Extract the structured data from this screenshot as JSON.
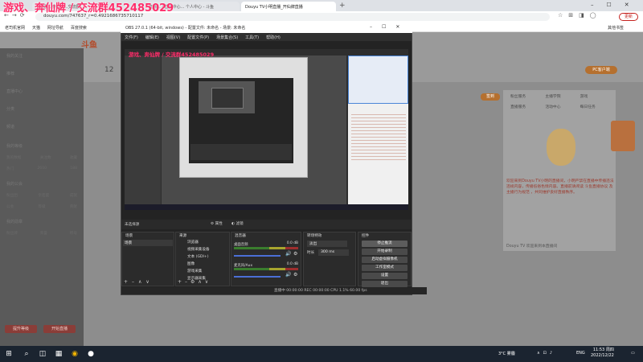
{
  "overlay_text": "游戏、奔仙牌 / 交流群452485029",
  "browser": {
    "tabs": [
      {
        "label": "交流群...奔仙牌...交流群...",
        "active": false
      },
      {
        "label": "直播... / 直播中心... 个人中心 - 斗鱼",
        "active": false
      },
      {
        "label": "Douyu TV小明直播_开仙牌直播",
        "active": true
      }
    ],
    "new_tab": "+",
    "url": "douyu.com/747637_r=0.4921686735710117",
    "bookmarks": [
      "老司机官网",
      "天猫",
      "网址导航",
      "百度搜索",
      "其他书签"
    ],
    "update_btn": "更新"
  },
  "site": {
    "logo": "斗鱼",
    "sidebar": {
      "items": [
        "我的关注",
        "推荐",
        "直播中心",
        "分类",
        "频道"
      ],
      "sections": [
        {
          "title": "我的等级",
          "rows": [
            [
              "我的数据",
              "1",
              "关注数",
              "0",
              "收藏",
              "0"
            ],
            [
              "热门",
              "2600",
              "开播量",
              "0",
              "在线",
              "188"
            ]
          ]
        },
        {
          "title": "我的公会",
          "rows": [
            [
              "粉丝团",
              "0",
              "亲密度",
              "0",
              "成就",
              "0"
            ],
            [
              "公会",
              "1",
              "等级",
              "3",
              "贡献",
              "0"
            ]
          ]
        },
        {
          "title": "我的勋章",
          "rows": [
            [
              "粉丝牌",
              "0",
              "荣誉",
              "0",
              "称号",
              "0"
            ]
          ]
        }
      ],
      "btn1": "提升等级",
      "btn2": "开始直播"
    },
    "topright": {
      "pc_badge": "PC客户端",
      "open_stream": "开播",
      "checkin": "签到"
    },
    "right_panel": {
      "rows": [
        "粉丝服务",
        "主播学院",
        "游戏",
        "直播服务",
        "活动中心",
        "每日任务"
      ],
      "text": "欢迎来到Douyu TV小明的直播间，小明严禁在直播中传播违法违规内容，传播低俗色情内容。直播前请阅读 斗鱼直播协议 及 主播行为规范 ，共同维护良好直播秩序。",
      "footer": "Douyu TV 欢迎来到本直播间"
    },
    "left_ticker": "12"
  },
  "obs": {
    "title": "OBS 27.0.1 (64-bit, windows) - 配置文件: 未命名 - 场景: 未命名",
    "menu": [
      "文件(F)",
      "编辑(E)",
      "视图(V)",
      "配置文件(P)",
      "场景集合(S)",
      "工具(T)",
      "帮助(H)"
    ],
    "status_bar": "直播中 00:00:00 REC 00:00:00 CPU 1.1% 60.00 fps",
    "preview_label": "未选择源",
    "props_btn": "属性",
    "filters_btn": "滤镜",
    "docks": {
      "scenes": {
        "title": "场景",
        "items": [
          "场景"
        ]
      },
      "sources": {
        "title": "来源",
        "items": [
          "浏览器",
          "视频采集设备",
          "文本 (GDI+)",
          "图像",
          "游戏采集",
          "显示器采集"
        ]
      },
      "mixer": {
        "title": "混音器",
        "channels": [
          {
            "name": "桌面音频",
            "db": "0.0 dB"
          },
          {
            "name": "麦克风/Aux",
            "db": "0.0 dB"
          }
        ]
      },
      "transitions": {
        "title": "转场特效",
        "type": "淡出",
        "duration_label": "时长",
        "duration": "300 ms"
      },
      "controls": {
        "title": "控件",
        "buttons": [
          "停止推流",
          "开始录制",
          "启动虚拟摄像机",
          "工作室模式",
          "设置",
          "退出"
        ]
      }
    }
  },
  "taskbar": {
    "weather": "3°C 雾霾",
    "lang": "ENG",
    "time": "11:53 周四",
    "date": "2022/12/22"
  },
  "colors": {
    "orange": "#ff7a1a",
    "red_text": "#e8322a",
    "obs_bg": "#232323",
    "browser_bar": "#dfe3e8"
  }
}
